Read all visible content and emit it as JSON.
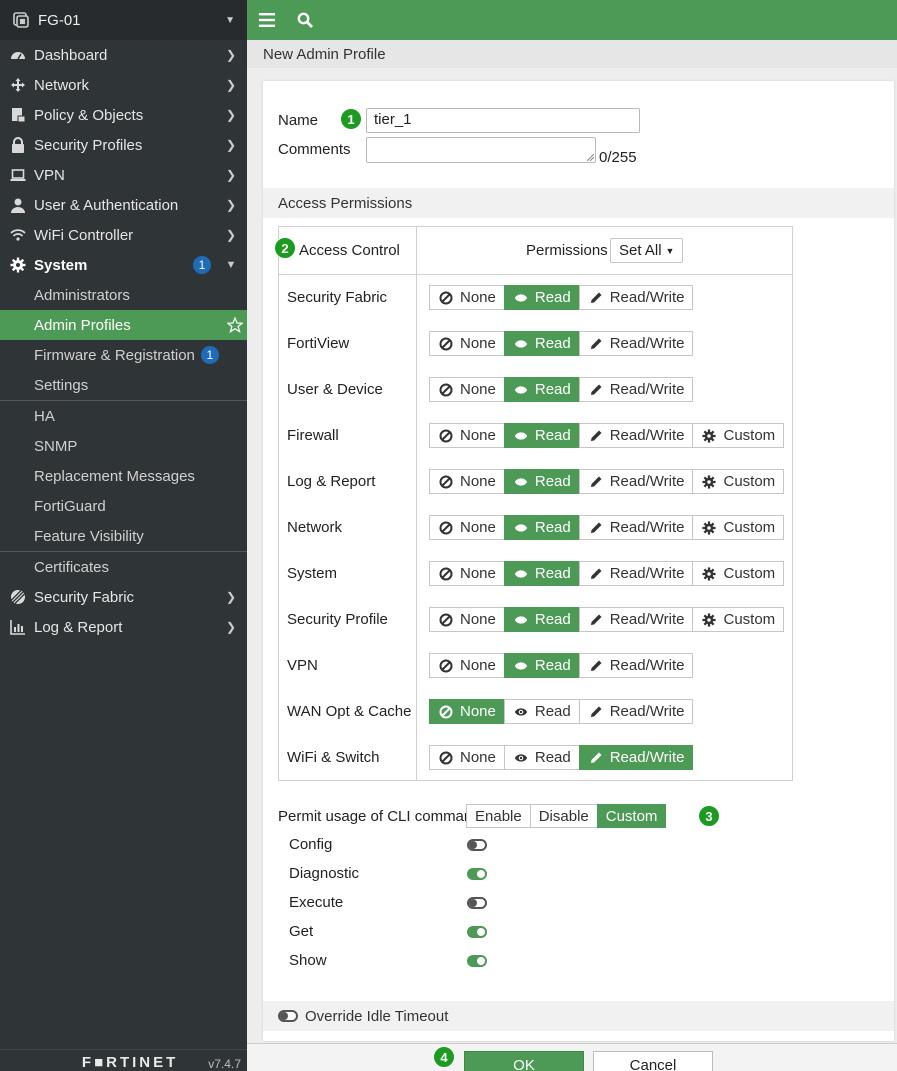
{
  "sidebar": {
    "device": "FG-01",
    "items": [
      {
        "label": "Dashboard",
        "icon": "dashboard-icon"
      },
      {
        "label": "Network",
        "icon": "network-icon"
      },
      {
        "label": "Policy & Objects",
        "icon": "policy-icon"
      },
      {
        "label": "Security Profiles",
        "icon": "lock-icon"
      },
      {
        "label": "VPN",
        "icon": "laptop-icon"
      },
      {
        "label": "User & Authentication",
        "icon": "user-icon"
      },
      {
        "label": "WiFi Controller",
        "icon": "wifi-icon"
      },
      {
        "label": "System",
        "icon": "gear-icon",
        "badge": "1"
      }
    ],
    "system_sub": [
      {
        "label": "Administrators"
      },
      {
        "label": "Admin Profiles"
      },
      {
        "label": "Firmware & Registration",
        "badge": "1"
      },
      {
        "label": "Settings"
      },
      {
        "label": "HA"
      },
      {
        "label": "SNMP"
      },
      {
        "label": "Replacement Messages"
      },
      {
        "label": "FortiGuard"
      },
      {
        "label": "Feature Visibility"
      },
      {
        "label": "Certificates"
      }
    ],
    "bottom_items": [
      {
        "label": "Security Fabric",
        "icon": "fabric-icon"
      },
      {
        "label": "Log & Report",
        "icon": "chart-icon"
      }
    ],
    "footer_logo": "F■RTINET",
    "footer_version": "v7.4.7"
  },
  "breadcrumb": "New Admin Profile",
  "form": {
    "name_label": "Name",
    "name_value": "tier_1",
    "comments_label": "Comments",
    "comments_count": "0/255",
    "access_permissions": "Access Permissions",
    "access_control": "Access Control",
    "permissions": "Permissions",
    "set_all": "Set All",
    "btn_none": "None",
    "btn_read": "Read",
    "btn_readwrite": "Read/Write",
    "btn_custom": "Custom",
    "rows": [
      {
        "label": "Security Fabric",
        "selected": "Read",
        "custom": false
      },
      {
        "label": "FortiView",
        "selected": "Read",
        "custom": false
      },
      {
        "label": "User & Device",
        "selected": "Read",
        "custom": false
      },
      {
        "label": "Firewall",
        "selected": "Read",
        "custom": true
      },
      {
        "label": "Log & Report",
        "selected": "Read",
        "custom": true
      },
      {
        "label": "Network",
        "selected": "Read",
        "custom": true
      },
      {
        "label": "System",
        "selected": "Read",
        "custom": true
      },
      {
        "label": "Security Profile",
        "selected": "Read",
        "custom": true
      },
      {
        "label": "VPN",
        "selected": "Read",
        "custom": false
      },
      {
        "label": "WAN Opt & Cache",
        "selected": "None",
        "custom": false
      },
      {
        "label": "WiFi & Switch",
        "selected": "Read/Write",
        "custom": false
      }
    ],
    "cli_label": "Permit usage of CLI commands",
    "cli_options": [
      "Enable",
      "Disable",
      "Custom"
    ],
    "cli_selected": "Custom",
    "cli_toggles": [
      {
        "label": "Config",
        "on": false
      },
      {
        "label": "Diagnostic",
        "on": true
      },
      {
        "label": "Execute",
        "on": false
      },
      {
        "label": "Get",
        "on": true
      },
      {
        "label": "Show",
        "on": true
      }
    ],
    "override_idle": "Override Idle Timeout",
    "ok": "OK",
    "cancel": "Cancel"
  },
  "steps": [
    "1",
    "2",
    "3",
    "4"
  ]
}
